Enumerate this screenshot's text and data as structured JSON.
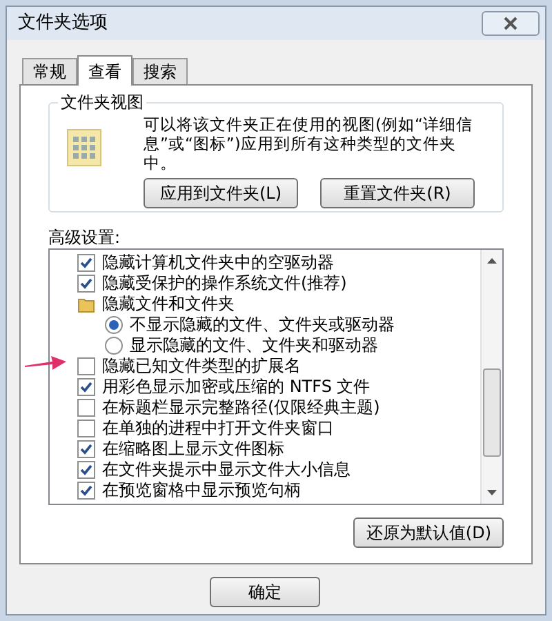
{
  "window": {
    "title": "文件夹选项"
  },
  "tabs": [
    {
      "label": "常规",
      "selected": false
    },
    {
      "label": "查看",
      "selected": true
    },
    {
      "label": "搜索",
      "selected": false
    }
  ],
  "folder_views": {
    "title": "文件夹视图",
    "description": "可以将该文件夹正在使用的视图(例如“详细信息”或“图标”)应用到所有这种类型的文件夹中。",
    "buttons": [
      "应用到文件夹(L)",
      "重置文件夹(R)"
    ]
  },
  "advanced": {
    "label": "高级设置:",
    "items": [
      {
        "kind": "checkbox",
        "label": "隐藏计算机文件夹中的空驱动器",
        "checked": true
      },
      {
        "kind": "checkbox",
        "label": "隐藏受保护的操作系统文件(推荐)",
        "checked": true
      },
      {
        "kind": "folder",
        "label": "隐藏文件和文件夹",
        "children": [
          {
            "kind": "radio",
            "label": "不显示隐藏的文件、文件夹或驱动器",
            "selected": true
          },
          {
            "kind": "radio",
            "label": "显示隐藏的文件、文件夹和驱动器",
            "selected": false
          }
        ]
      },
      {
        "kind": "checkbox",
        "label": "隐藏已知文件类型的扩展名",
        "checked": false
      },
      {
        "kind": "checkbox",
        "label": "用彩色显示加密或压缩的 NTFS 文件",
        "checked": true
      },
      {
        "kind": "checkbox",
        "label": "在标题栏显示完整路径(仅限经典主题)",
        "checked": false
      },
      {
        "kind": "checkbox",
        "label": "在单独的进程中打开文件夹窗口",
        "checked": false
      },
      {
        "kind": "checkbox",
        "label": "在缩略图上显示文件图标",
        "checked": true
      },
      {
        "kind": "checkbox",
        "label": "在文件夹提示中显示文件大小信息",
        "checked": true
      },
      {
        "kind": "checkbox",
        "label": "在预览窗格中显示预览句柄",
        "checked": true
      }
    ],
    "restore_button": "还原为默认值(D)"
  },
  "dialog_buttons": [
    "确定"
  ]
}
